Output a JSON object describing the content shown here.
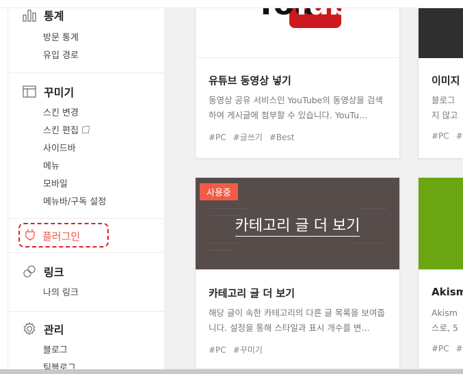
{
  "sidebar": {
    "stats": {
      "title": "통계",
      "icon": "bar-chart-icon",
      "items": [
        "방문 통계",
        "유입 경로"
      ]
    },
    "decorate": {
      "title": "꾸미기",
      "icon": "layout-icon",
      "items": [
        "스킨 변경",
        "스킨 편집",
        "사이드바",
        "메뉴",
        "모바일",
        "메뉴바/구독 설정"
      ]
    },
    "plugin": {
      "title": "플러그인",
      "icon": "plug-icon"
    },
    "links": {
      "title": "링크",
      "icon": "link-icon",
      "items": [
        "나의 링크"
      ]
    },
    "manage": {
      "title": "관리",
      "icon": "gear-icon",
      "items": [
        "블로그",
        "팀블로그"
      ]
    }
  },
  "cards": [
    {
      "title": "유튜브 동영상 넣기",
      "desc": "동영상 공유 서비스인 YouTube의 동영상을 검색하여 게시글에 첨부할 수 있습니다. YouTu…",
      "tags": [
        "#PC",
        "#글쓰기",
        "#Best"
      ],
      "thumb_brand": {
        "you": "You",
        "tube": "Tube"
      }
    },
    {
      "title": "이미지",
      "desc": "블로그에 올린 이미지를 다른 사람이 쉽게 가져가지 않고…",
      "desc_lines": [
        "블로그",
        "지 않고"
      ],
      "tags": [
        "#PC",
        "#"
      ]
    },
    {
      "title": "카테고리 글 더 보기",
      "desc": "해당 글이 속한 카테고리의 다른 글 목록을 보여줍니다. 설정을 통해 스타일과 표시 개수를 변…",
      "tags": [
        "#PC",
        "#꾸미기"
      ],
      "badge": "사용중",
      "thumb_text": "카테고리 글 더 보기"
    },
    {
      "title": "Akism",
      "desc_lines": [
        "Akism",
        "스로, 5"
      ],
      "tags": [
        "#PC",
        "#"
      ]
    }
  ],
  "colors": {
    "accent": "#f25c47",
    "plugin_highlight": "#e02020",
    "category_thumb": "#564d4b",
    "akismet_thumb": "#6aa512",
    "youtube_red": "#cc181e"
  }
}
